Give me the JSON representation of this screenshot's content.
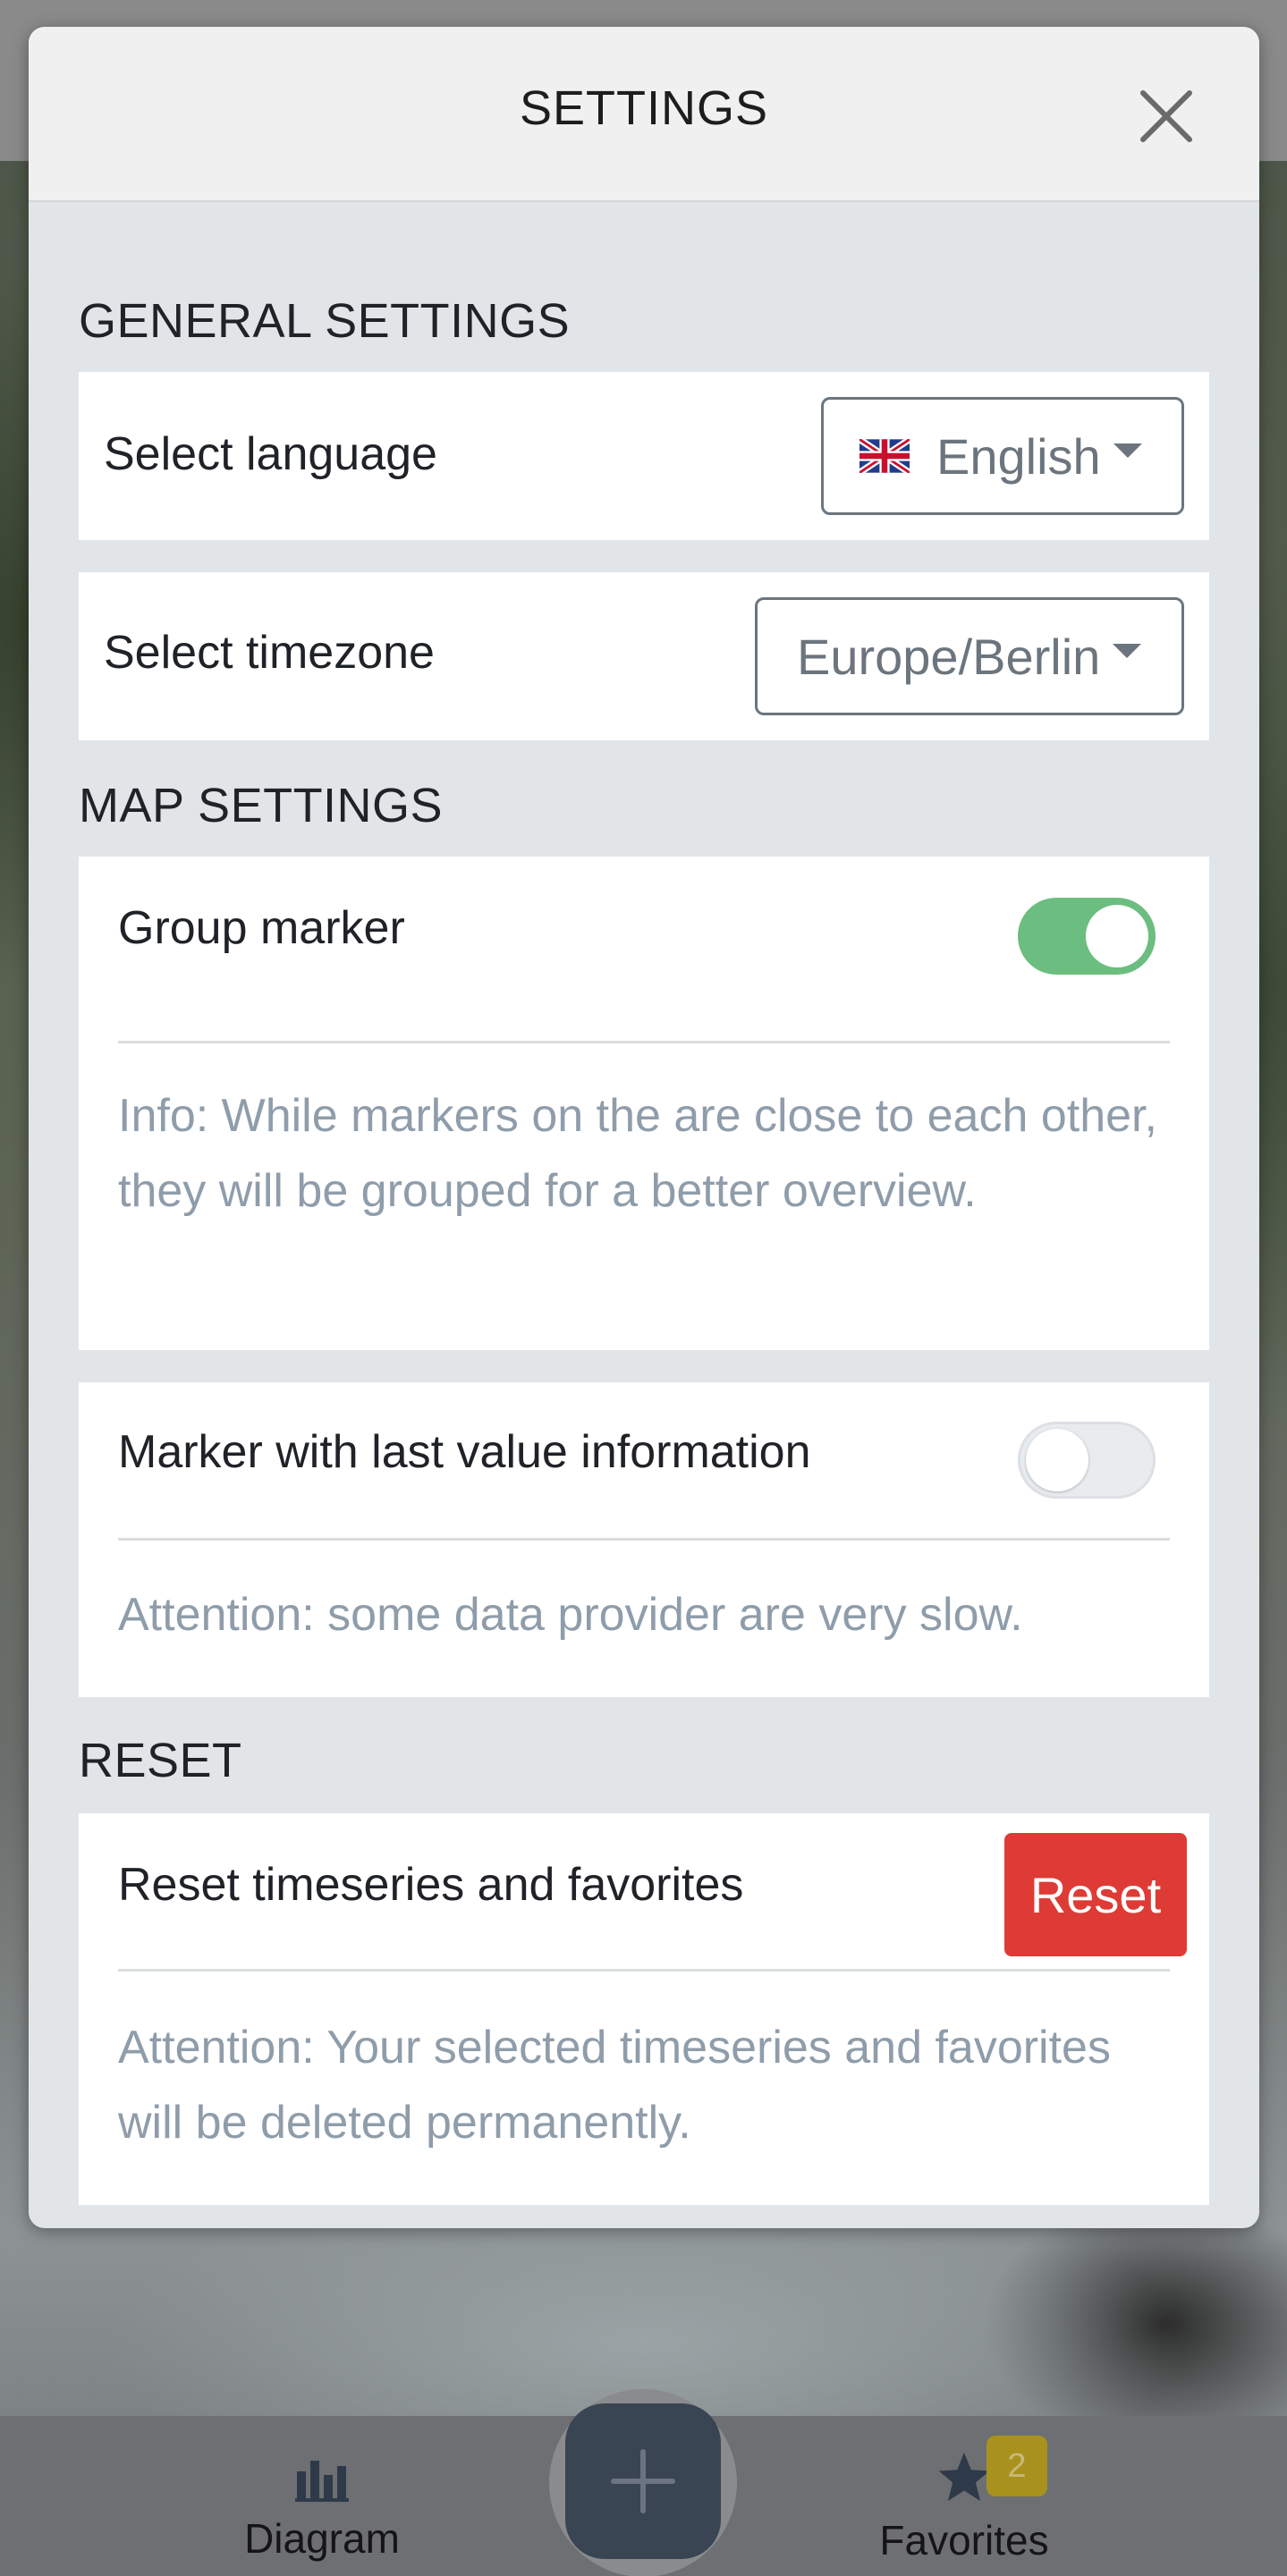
{
  "modal": {
    "title": "SETTINGS",
    "close_icon": "close-icon"
  },
  "general": {
    "section_title": "GENERAL SETTINGS",
    "language_label": "Select language",
    "language_value": "English",
    "language_flag": "uk-flag-icon",
    "timezone_label": "Select timezone",
    "timezone_value": "Europe/Berlin"
  },
  "map": {
    "section_title": "MAP SETTINGS",
    "group_marker_label": "Group marker",
    "group_marker_enabled": true,
    "group_marker_info": "Info: While markers on the are close to each other, they will be grouped for a better overview.",
    "last_value_label": "Marker with last value information",
    "last_value_enabled": false,
    "last_value_info": "Attention: some data provider are very slow."
  },
  "reset": {
    "section_title": "RESET",
    "label": "Reset timeseries and favorites",
    "button_label": "Reset",
    "info": "Attention: Your selected timeseries and favorites will be deleted permanently."
  },
  "bottom_nav": {
    "diagram_label": "Diagram",
    "favorites_label": "Favorites",
    "favorites_count": "2"
  },
  "colors": {
    "toggle_on": "#6bbe7f",
    "danger": "#de3b36",
    "info_text": "#8f9daa",
    "badge": "#a8921d"
  }
}
